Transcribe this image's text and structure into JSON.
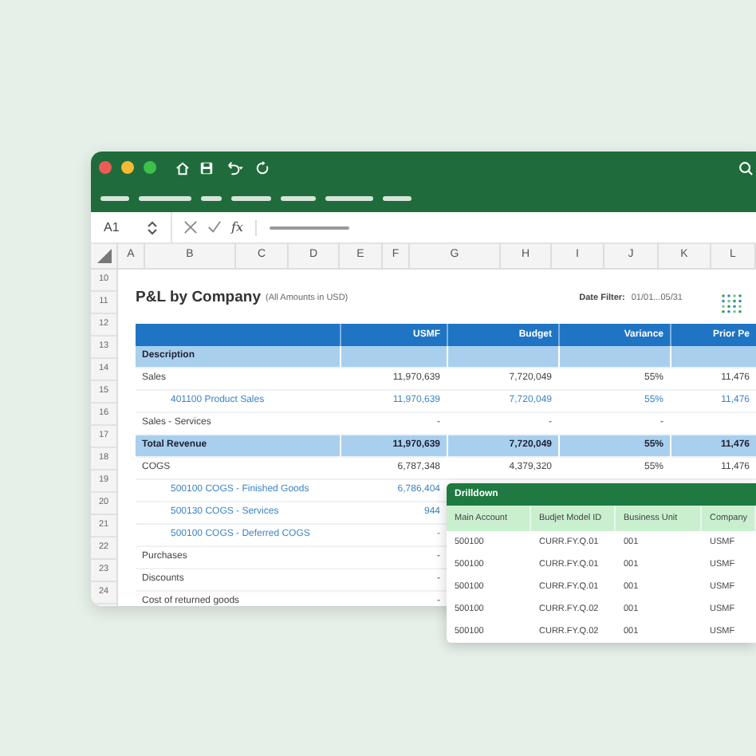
{
  "formula_bar": {
    "name_box": "A1",
    "function_button": "fx"
  },
  "column_headers": [
    "A",
    "B",
    "C",
    "D",
    "E",
    "F",
    "G",
    "H",
    "I",
    "J",
    "K",
    "L"
  ],
  "row_numbers": [
    "10",
    "11",
    "12",
    "13",
    "14",
    "15",
    "16",
    "17",
    "18",
    "19",
    "20",
    "21",
    "22",
    "23",
    "24"
  ],
  "report": {
    "title": "P&L by Company",
    "subtitle": "(All Amounts in USD)",
    "date_filter_label": "Date Filter:",
    "date_filter_value": "01/01...05/31",
    "columns": [
      "USMF",
      "Budget",
      "Variance",
      "Prior Pe"
    ],
    "rows": [
      {
        "kind": "section",
        "label": "Description"
      },
      {
        "kind": "line",
        "label": "Sales",
        "values": [
          "11,970,639",
          "7,720,049",
          "55%",
          "11,476"
        ]
      },
      {
        "kind": "account",
        "label": "401100 Product Sales",
        "values": [
          "11,970,639",
          "7,720,049",
          "55%",
          "11,476"
        ]
      },
      {
        "kind": "line",
        "label": "Sales - Services",
        "values": [
          "-",
          "-",
          "-"
        ]
      },
      {
        "kind": "total",
        "label": "Total Revenue",
        "values": [
          "11,970,639",
          "7,720,049",
          "55%",
          "11,476"
        ]
      },
      {
        "kind": "line",
        "label": "COGS",
        "values": [
          "6,787,348",
          "4,379,320",
          "55%",
          "11,476"
        ]
      },
      {
        "kind": "account",
        "label": "500100 COGS - Finished Goods",
        "values": [
          "6,786,404"
        ]
      },
      {
        "kind": "account",
        "label": "500130 COGS - Services",
        "values": [
          "944"
        ]
      },
      {
        "kind": "account",
        "label": "500100 COGS - Deferred COGS",
        "values": [
          "-"
        ]
      },
      {
        "kind": "line",
        "label": "Purchases",
        "values": [
          "-"
        ]
      },
      {
        "kind": "line",
        "label": "Discounts",
        "values": [
          "-"
        ]
      },
      {
        "kind": "line",
        "label": "Cost of returned goods",
        "values": [
          "-"
        ]
      }
    ]
  },
  "drilldown": {
    "title": "Drilldown",
    "columns": [
      "Main Account",
      "Budjet Model ID",
      "Business Unit",
      "Company"
    ],
    "rows": [
      [
        "500100",
        "CURR.FY.Q.01",
        "001",
        "USMF"
      ],
      [
        "500100",
        "CURR.FY.Q.01",
        "001",
        "USMF"
      ],
      [
        "500100",
        "CURR.FY.Q.01",
        "001",
        "USMF"
      ],
      [
        "500100",
        "CURR.FY.Q.02",
        "001",
        "USMF"
      ],
      [
        "500100",
        "CURR.FY.Q.02",
        "001",
        "USMF"
      ]
    ]
  }
}
